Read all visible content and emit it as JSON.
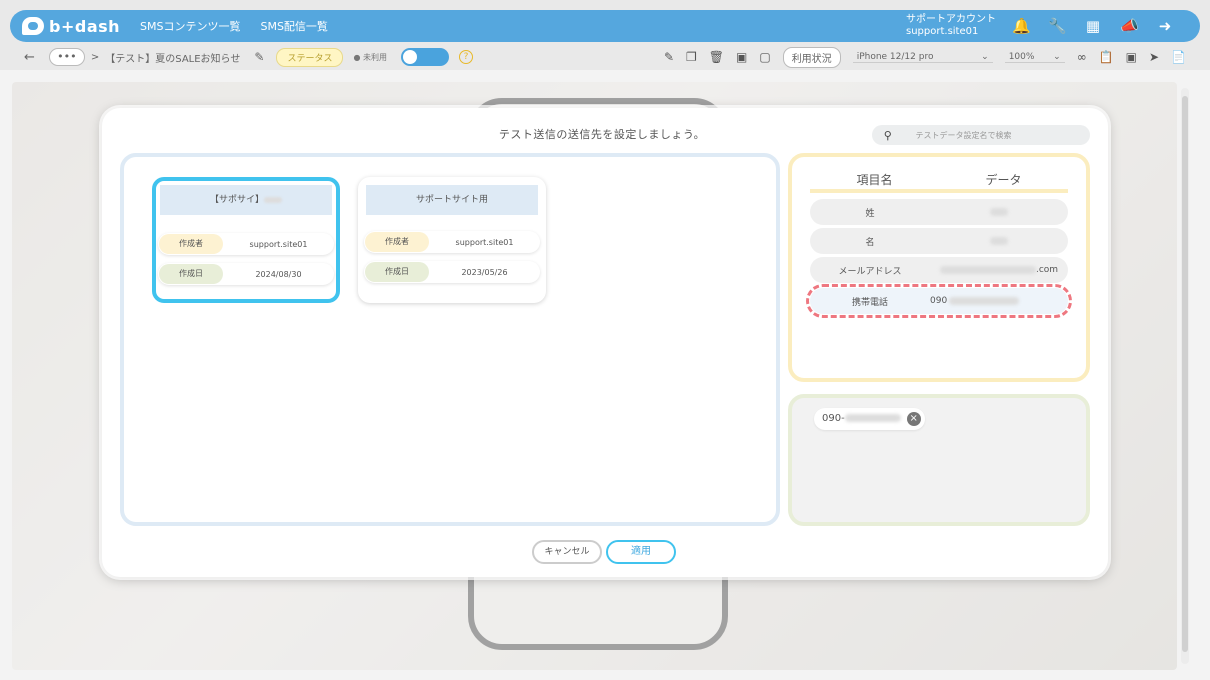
{
  "app": {
    "logo": "b+dash"
  },
  "topnav": {
    "items": [
      "SMSコンテンツ一覧",
      "SMS配信一覧"
    ]
  },
  "account": {
    "line1": "サポートアカウント",
    "line2": "support.site01"
  },
  "toolbar": {
    "breadcrumb": "【テスト】夏のSALEお知らせ",
    "status_label": "ステータス",
    "unused_label": "未利用",
    "usage_label": "利用状況",
    "device_select": "iPhone 12/12 pro",
    "zoom_select": "100%",
    "dots": "•••"
  },
  "modal": {
    "title": "テスト送信の送信先を設定しましょう。",
    "search_placeholder": "テストデータ設定名で検索",
    "cards": [
      {
        "title": "【サポサイ】",
        "author_label": "作成者",
        "author": "support.site01",
        "date_label": "作成日",
        "date": "2024/08/30",
        "selected": true
      },
      {
        "title": "サポートサイト用",
        "author_label": "作成者",
        "author": "support.site01",
        "date_label": "作成日",
        "date": "2023/05/26",
        "selected": false
      }
    ],
    "data_table": {
      "col_item": "項目名",
      "col_data": "データ",
      "rows": [
        {
          "key": "姓",
          "value": ""
        },
        {
          "key": "名",
          "value": ""
        },
        {
          "key": "メールアドレス",
          "value": ".com"
        },
        {
          "key": "携帯電話",
          "value": "090"
        }
      ]
    },
    "recipient": "090-",
    "cancel_label": "キャンセル",
    "apply_label": "適用"
  },
  "colors": {
    "accent": "#55a7de",
    "selected_border": "#40c3ee",
    "highlight_dash": "#ee7780"
  }
}
